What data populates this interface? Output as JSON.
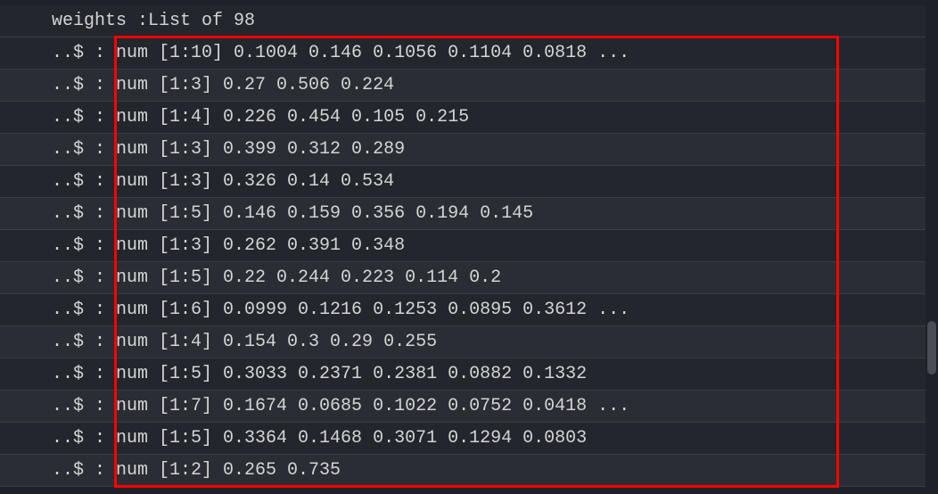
{
  "console": {
    "header": " weights :List of 98",
    "prefix": " ..$ : ",
    "rows": [
      "num [1:10] 0.1004 0.146 0.1056 0.1104 0.0818 ...",
      "num [1:3] 0.27 0.506 0.224",
      "num [1:4] 0.226 0.454 0.105 0.215",
      "num [1:3] 0.399 0.312 0.289",
      "num [1:3] 0.326 0.14 0.534",
      "num [1:5] 0.146 0.159 0.356 0.194 0.145",
      "num [1:3] 0.262 0.391 0.348",
      "num [1:5] 0.22 0.244 0.223 0.114 0.2",
      "num [1:6] 0.0999 0.1216 0.1253 0.0895 0.3612 ...",
      "num [1:4] 0.154 0.3 0.29 0.255",
      "num [1:5] 0.3033 0.2371 0.2381 0.0882 0.1332",
      "num [1:7] 0.1674 0.0685 0.1022 0.0752 0.0418 ...",
      "num [1:5] 0.3364 0.1468 0.3071 0.1294 0.0803",
      "num [1:2] 0.265 0.735"
    ]
  }
}
